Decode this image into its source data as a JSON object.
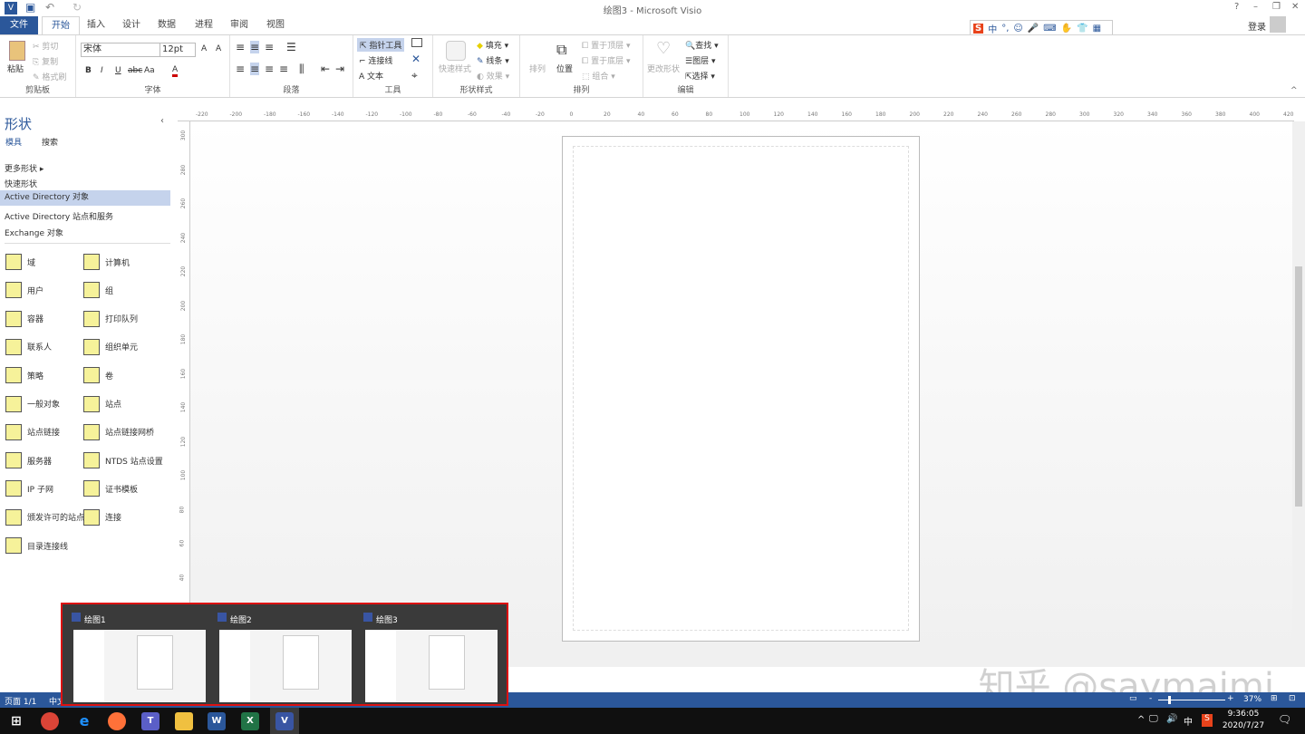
{
  "window": {
    "title": "绘图3 - Microsoft Visio",
    "help": "?",
    "minimize": "–",
    "restore": "❐",
    "close": "✕",
    "login": "登录"
  },
  "ime": {
    "items": [
      "S",
      "中",
      "°,",
      "☺",
      "🎤",
      "⌨",
      "✋",
      "👕",
      "▦"
    ]
  },
  "tabs": [
    "文件",
    "开始",
    "插入",
    "设计",
    "数据",
    "进程",
    "审阅",
    "视图"
  ],
  "active_tab": "开始",
  "ribbon": {
    "clipboard": {
      "label": "剪贴板",
      "paste": "粘贴",
      "cut": "剪切",
      "copy": "复制",
      "format_painter": "格式刷"
    },
    "font": {
      "label": "字体",
      "font_name": "宋体",
      "font_size": "12pt",
      "bold": "B",
      "italic": "I",
      "underline": "U",
      "strike": "abc",
      "case": "Aa",
      "color": "A",
      "grow": "A",
      "shrink": "A"
    },
    "paragraph": {
      "label": "段落"
    },
    "tools": {
      "label": "工具",
      "pointer": "指针工具",
      "connector": "连接线",
      "text": "文本"
    },
    "shape_styles": {
      "label": "形状样式",
      "quick_styles": "快速样式",
      "fill": "填充",
      "line": "线条",
      "effects": "效果"
    },
    "arrange": {
      "label": "排列",
      "align": "排列",
      "position": "位置",
      "bring_front": "置于顶层",
      "send_back": "置于底层",
      "group": "组合"
    },
    "editing": {
      "label": "编辑",
      "change_shape": "更改形状",
      "find": "查找",
      "layers": "图层",
      "select": "选择"
    }
  },
  "shapes_pane": {
    "title": "形状",
    "tabs": [
      "模具",
      "搜索"
    ],
    "links": [
      "更多形状",
      "快速形状",
      "Active Directory 对象",
      "Active Directory 站点和服务",
      "Exchange 对象"
    ],
    "selected": "Active Directory 对象",
    "stencil": [
      [
        "域",
        "计算机"
      ],
      [
        "用户",
        "组"
      ],
      [
        "容器",
        "打印队列"
      ],
      [
        "联系人",
        "组织单元"
      ],
      [
        "策略",
        "卷"
      ],
      [
        "一般对象",
        "站点"
      ],
      [
        "站点链接",
        "站点链接网桥"
      ],
      [
        "服务器",
        "NTDS 站点设置"
      ],
      [
        "IP 子网",
        "证书模板"
      ],
      [
        "颁发许可的站点",
        "连接"
      ],
      [
        "目录连接线",
        ""
      ]
    ]
  },
  "ruler": {
    "top": [
      "-220",
      "-200",
      "-180",
      "-160",
      "-140",
      "-120",
      "-100",
      "-80",
      "-60",
      "-40",
      "-20",
      "0",
      "20",
      "40",
      "60",
      "80",
      "100",
      "120",
      "140",
      "160",
      "180",
      "200",
      "220",
      "240",
      "260",
      "280",
      "300",
      "320",
      "340",
      "360",
      "380",
      "400",
      "420"
    ],
    "left": [
      "300",
      "280",
      "260",
      "240",
      "220",
      "200",
      "180",
      "160",
      "140",
      "120",
      "100",
      "80",
      "60",
      "40"
    ]
  },
  "switcher": {
    "windows": [
      "绘图1",
      "绘图2",
      "绘图3"
    ]
  },
  "status": {
    "page": "页面 1/1",
    "lang": "中文",
    "zoom": "37%",
    "zoom_minus": "-",
    "zoom_plus": "+"
  },
  "taskbar": {
    "apps": [
      "chrome",
      "edge",
      "firefox",
      "teams",
      "explorer",
      "word",
      "excel",
      "visio"
    ],
    "time": "9:36:05",
    "date": "2020/7/27",
    "ime": "中",
    "tray_up": "^"
  },
  "watermark": "知乎 @saymaimi",
  "colors": {
    "accent": "#2b579a",
    "highlight": "#c5d3ec",
    "switcher_border": "#d11111"
  }
}
